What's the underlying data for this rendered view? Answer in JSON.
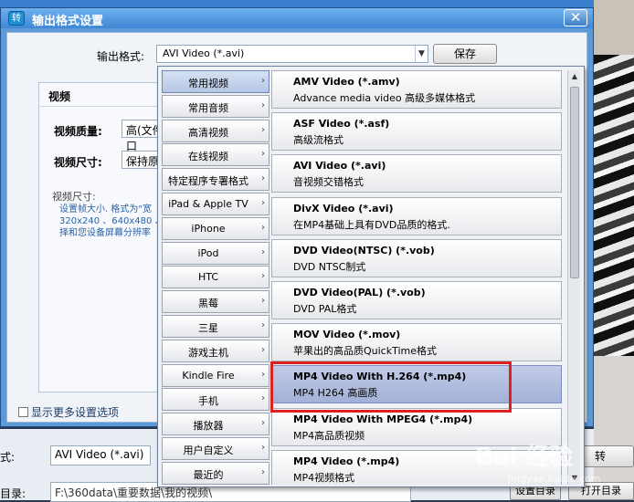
{
  "dialog": {
    "title": "输出格式设置",
    "app_icon": "转",
    "close": "✕",
    "format_label": "输出格式:",
    "format_value": "AVI Video (*.avi)",
    "save_label": "保存",
    "group_title": "视频",
    "quality_label": "视频质量:",
    "quality_value": "高(文件口",
    "size_label": "视频尺寸:",
    "size_value": "保持原样",
    "desc_title": "视频尺寸:",
    "desc_body": "设置帧大小. 格式为\"宽 320x240 、640x480 、19 择和您设备屏幕分辨率",
    "more_settings": "显示更多设置选项"
  },
  "lower": {
    "format_label": "式:",
    "format_value": "AVI Video (*.avi)",
    "dir_label": "目录:",
    "dir_value": "F:\\360data\\重要数据\\我的视频\\",
    "set_dir": "设置目录",
    "open_dir": "打开目录",
    "convert": "转"
  },
  "menu": {
    "categories": [
      {
        "label": "常用视频",
        "active": true
      },
      {
        "label": "常用音频"
      },
      {
        "label": "高清视频"
      },
      {
        "label": "在线视频"
      },
      {
        "label": "特定程序专署格式"
      },
      {
        "label": "iPad & Apple TV"
      },
      {
        "label": "iPhone"
      },
      {
        "label": "iPod"
      },
      {
        "label": "HTC"
      },
      {
        "label": "黑莓"
      },
      {
        "label": "三星"
      },
      {
        "label": "游戏主机"
      },
      {
        "label": "Kindle Fire"
      },
      {
        "label": "手机"
      },
      {
        "label": "播放器"
      },
      {
        "label": "用户自定义"
      },
      {
        "label": "最近的"
      }
    ],
    "items": [
      {
        "name": "AMV Video (*.amv)",
        "desc": "Advance media video 高级多媒体格式"
      },
      {
        "name": "ASF Video (*.asf)",
        "desc": "高级流格式"
      },
      {
        "name": "AVI Video (*.avi)",
        "desc": "音视频交错格式"
      },
      {
        "name": "DivX Video (*.avi)",
        "desc": "在MP4基础上具有DVD品质的格式."
      },
      {
        "name": "DVD Video(NTSC) (*.vob)",
        "desc": "DVD  NTSC制式"
      },
      {
        "name": "DVD Video(PAL) (*.vob)",
        "desc": "DVD PAL格式"
      },
      {
        "name": "MOV Video (*.mov)",
        "desc": "苹果出的高品质QuickTime格式"
      },
      {
        "name": "MP4 Video With H.264 (*.mp4)",
        "desc": "MP4 H264 高画质",
        "selected": true
      },
      {
        "name": "MP4 Video With MPEG4 (*.mp4)",
        "desc": "MP4高品质视频"
      },
      {
        "name": "MP4 Video (*.mp4)",
        "desc": "MP4视频格式"
      }
    ],
    "arrow": "›"
  },
  "watermark": {
    "text": "Bai 经验",
    "sub": "jingyan.baidu.com"
  },
  "colors": {
    "highlight": "#e02020",
    "title_bar": "#3f88d6"
  }
}
